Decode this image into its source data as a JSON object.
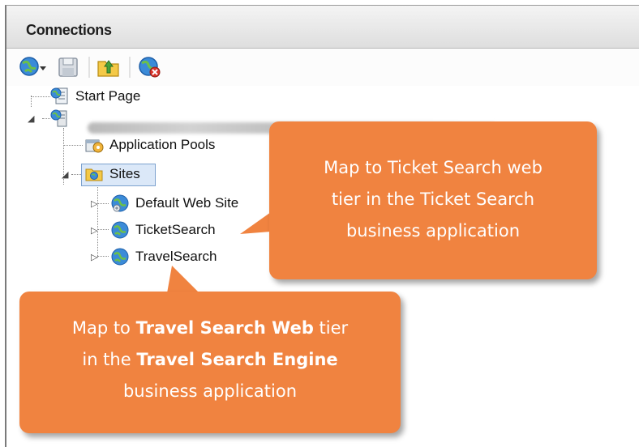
{
  "panel": {
    "title": "Connections"
  },
  "toolbar": {
    "buttons": [
      {
        "icon": "connect-globe-dropdown-icon"
      },
      {
        "icon": "save-icon"
      },
      {
        "icon": "up-folder-icon"
      },
      {
        "icon": "disconnect-icon"
      }
    ]
  },
  "tree": {
    "start_page": "Start Page",
    "server": "",
    "app_pools": "Application Pools",
    "sites": "Sites",
    "default_site": "Default Web Site",
    "ticket": "TicketSearch",
    "travel": "TravelSearch"
  },
  "callouts": {
    "ticket": {
      "line1": "Map to Ticket Search web",
      "line2": "tier in the Ticket Search",
      "line3": "business application"
    },
    "travel": {
      "l1_pre": "Map to ",
      "l1_bold": "Travel Search Web",
      "l1_post": " tier",
      "l2_pre": "in the ",
      "l2_bold": "Travel Search Engine",
      "l3": "business application"
    }
  },
  "colors": {
    "callout": "#f08340",
    "selection": "#dbe8f8"
  }
}
